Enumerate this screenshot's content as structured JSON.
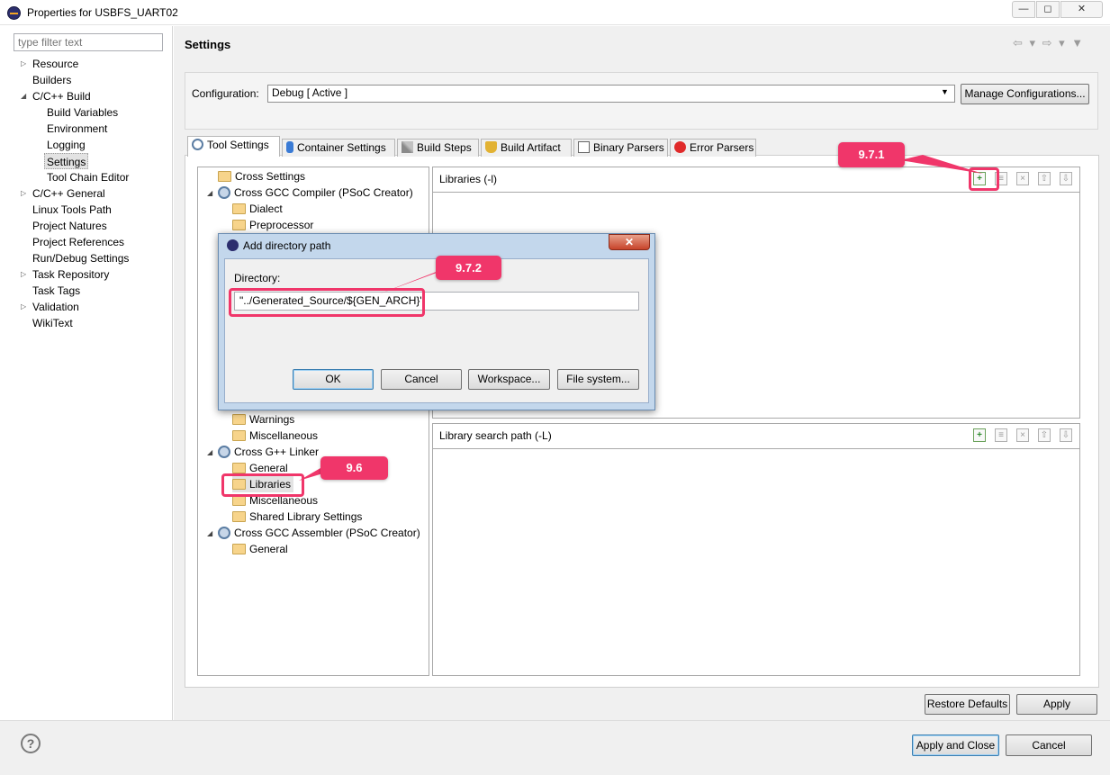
{
  "window": {
    "title": "Properties for USBFS_UART02",
    "min": "—",
    "max": "◻",
    "close": "✕"
  },
  "filter": {
    "placeholder": "type filter text"
  },
  "nav": [
    {
      "label": "Resource",
      "expander": "▷"
    },
    {
      "label": "Builders"
    },
    {
      "label": "C/C++ Build",
      "expander": "◢"
    },
    {
      "label": "Build Variables"
    },
    {
      "label": "Environment"
    },
    {
      "label": "Logging"
    },
    {
      "label": "Settings"
    },
    {
      "label": "Tool Chain Editor"
    },
    {
      "label": "C/C++ General",
      "expander": "▷"
    },
    {
      "label": "Linux Tools Path"
    },
    {
      "label": "Project Natures"
    },
    {
      "label": "Project References"
    },
    {
      "label": "Run/Debug Settings"
    },
    {
      "label": "Task Repository",
      "expander": "▷"
    },
    {
      "label": "Task Tags"
    },
    {
      "label": "Validation",
      "expander": "▷"
    },
    {
      "label": "WikiText"
    }
  ],
  "settings": {
    "title": "Settings",
    "nav_arrows": "⇦ ▾ ⇨ ▾ ▼",
    "config_label": "Configuration:",
    "config_value": "Debug  [ Active ]",
    "config_arrow": "▼",
    "manage_label": "Manage Configurations..."
  },
  "tabs": [
    {
      "label": "Tool Settings"
    },
    {
      "label": "Container Settings"
    },
    {
      "label": "Build Steps"
    },
    {
      "label": "Build Artifact"
    },
    {
      "label": "Binary Parsers"
    },
    {
      "label": "Error Parsers"
    }
  ],
  "tree": {
    "cross_settings": "Cross Settings",
    "gcc_compiler": "Cross GCC Compiler (PSoC Creator)",
    "dialect": "Dialect",
    "preprocessor": "Preprocessor",
    "warnings": "Warnings",
    "misc1": "Miscellaneous",
    "gpp_linker": "Cross G++ Linker",
    "general1": "General",
    "libraries": "Libraries",
    "misc2": "Miscellaneous",
    "shared_lib": "Shared Library Settings",
    "gcc_assembler": "Cross GCC Assembler (PSoC Creator)",
    "general2": "General",
    "expand_open": "◢"
  },
  "panels": {
    "libraries_title": "Libraries (-l)",
    "search_path_title": "Library search path (-L)",
    "icon_add": "+",
    "icon_edit": "≡",
    "icon_delete": "×",
    "icon_up": "⇧",
    "icon_down": "⇩"
  },
  "bottom": {
    "restore_label": "Restore Defaults",
    "apply_label": "Apply",
    "help": "?",
    "apply_close_label": "Apply and Close",
    "cancel_label": "Cancel"
  },
  "dialog": {
    "title": "Add directory path",
    "close": "✕",
    "directory_label": "Directory:",
    "directory_value": "\"../Generated_Source/${GEN_ARCH}\"",
    "ok_label": "OK",
    "cancel_label": "Cancel",
    "workspace_label": "Workspace...",
    "filesystem_label": "File system..."
  },
  "callouts": {
    "c971": "9.7.1",
    "c972": "9.7.2",
    "c96": "9.6"
  },
  "colors": {
    "callout": "#f0366a"
  }
}
